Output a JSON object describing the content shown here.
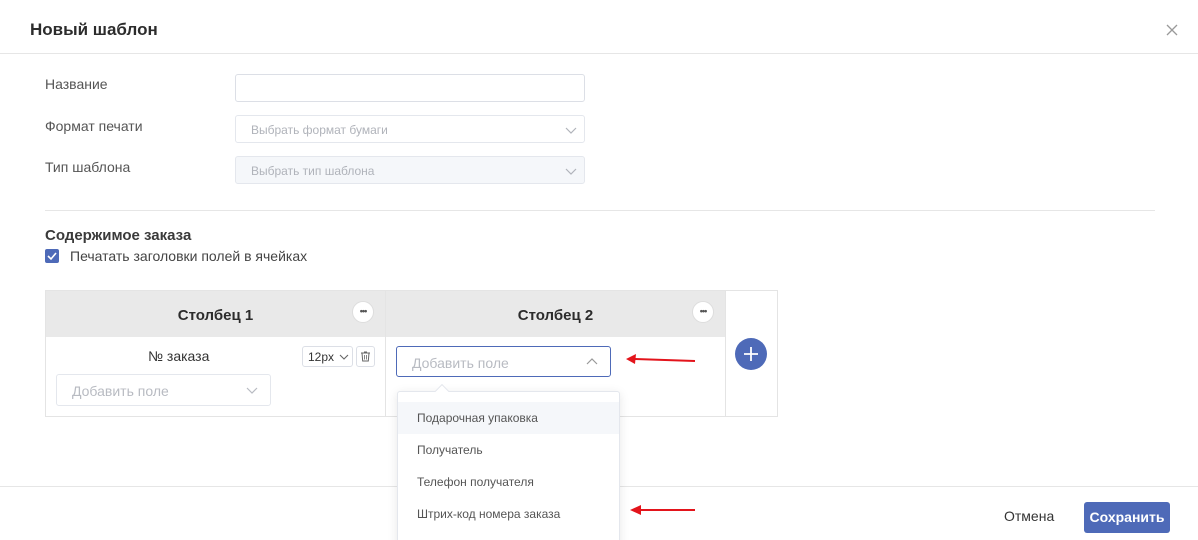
{
  "modal": {
    "title": "Новый шаблон"
  },
  "form": {
    "name_label": "Название",
    "name_value": "",
    "format_label": "Формат печати",
    "format_placeholder": "Выбрать формат бумаги",
    "type_label": "Тип шаблона",
    "type_placeholder": "Выбрать тип шаблона"
  },
  "content": {
    "section_title": "Содержимое заказа",
    "print_headers_label": "Печатать заголовки полей в ячейках",
    "print_headers_checked": true,
    "more_icon_text": "•••",
    "columns": [
      {
        "title": "Столбец 1",
        "field_name": "№ заказа",
        "font_size": "12px",
        "add_field_placeholder": "Добавить поле"
      },
      {
        "title": "Столбец 2",
        "add_field_placeholder": "Добавить поле"
      }
    ],
    "dropdown_items": [
      "Подарочная упаковка",
      "Получатель",
      "Телефон получателя",
      "Штрих-код номера заказа"
    ]
  },
  "footer": {
    "cancel_label": "Отмена",
    "save_label": "Сохранить"
  },
  "colors": {
    "accent": "#4e6ab8",
    "annotation_arrow": "#e3141b"
  }
}
